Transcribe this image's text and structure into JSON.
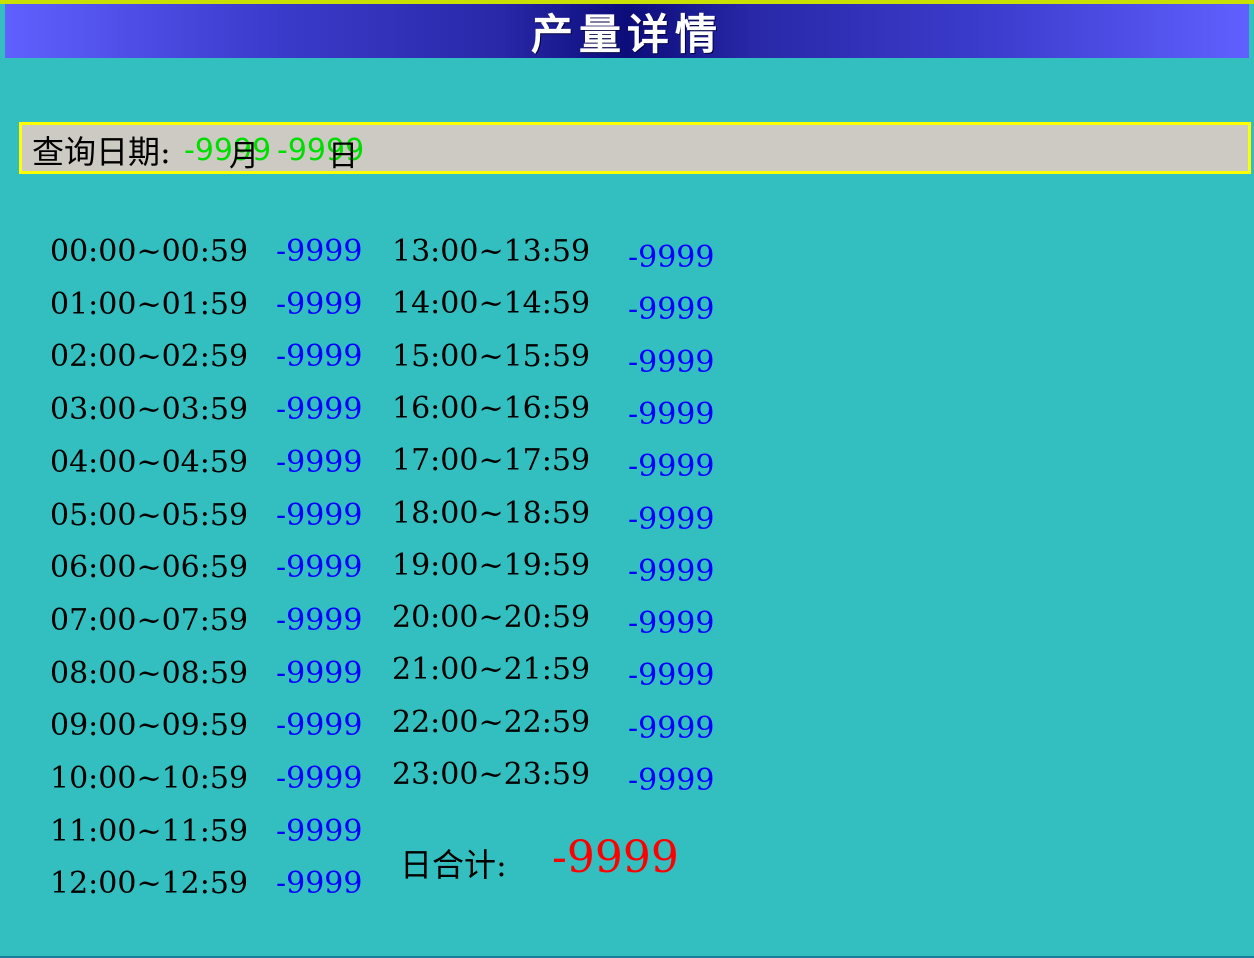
{
  "title": "产量详情",
  "query": {
    "label": "查询日期:",
    "month_value": "-9999",
    "month_unit": "月",
    "day_value": "-9999",
    "day_unit": "日"
  },
  "hours_left": [
    {
      "range": "00:00~00:59",
      "value": "-9999"
    },
    {
      "range": "01:00~01:59",
      "value": "-9999"
    },
    {
      "range": "02:00~02:59",
      "value": "-9999"
    },
    {
      "range": "03:00~03:59",
      "value": "-9999"
    },
    {
      "range": "04:00~04:59",
      "value": "-9999"
    },
    {
      "range": "05:00~05:59",
      "value": "-9999"
    },
    {
      "range": "06:00~06:59",
      "value": "-9999"
    },
    {
      "range": "07:00~07:59",
      "value": "-9999"
    },
    {
      "range": "08:00~08:59",
      "value": "-9999"
    },
    {
      "range": "09:00~09:59",
      "value": "-9999"
    },
    {
      "range": "10:00~10:59",
      "value": "-9999"
    },
    {
      "range": "11:00~11:59",
      "value": "-9999"
    },
    {
      "range": "12:00~12:59",
      "value": "-9999"
    }
  ],
  "hours_right": [
    {
      "range": "13:00~13:59",
      "value": "-9999"
    },
    {
      "range": "14:00~14:59",
      "value": "-9999"
    },
    {
      "range": "15:00~15:59",
      "value": "-9999"
    },
    {
      "range": "16:00~16:59",
      "value": "-9999"
    },
    {
      "range": "17:00~17:59",
      "value": "-9999"
    },
    {
      "range": "18:00~18:59",
      "value": "-9999"
    },
    {
      "range": "19:00~19:59",
      "value": "-9999"
    },
    {
      "range": "20:00~20:59",
      "value": "-9999"
    },
    {
      "range": "21:00~21:59",
      "value": "-9999"
    },
    {
      "range": "22:00~22:59",
      "value": "-9999"
    },
    {
      "range": "23:00~23:59",
      "value": "-9999"
    }
  ],
  "total": {
    "label": "日合计:",
    "value": "-9999"
  },
  "colors": {
    "background": "#33bfbf",
    "value_blue": "#0000ff",
    "total_red": "#ff0000",
    "date_green": "#00dd00",
    "date_border": "#ffff00"
  }
}
